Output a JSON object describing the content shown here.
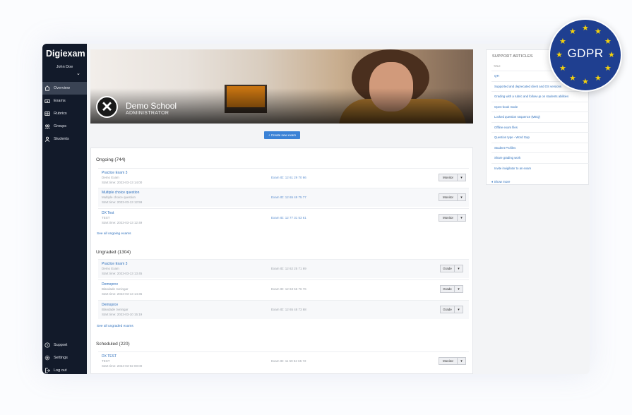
{
  "app": {
    "logo": "Digiexam"
  },
  "user": {
    "name": "John Doe"
  },
  "nav": {
    "items": [
      {
        "label": "Overview",
        "icon": "home-icon",
        "active": true
      },
      {
        "label": "Exams",
        "icon": "exams-icon",
        "active": false
      },
      {
        "label": "Rubrics",
        "icon": "rubrics-icon",
        "active": false
      },
      {
        "label": "Groups",
        "icon": "groups-icon",
        "active": false
      },
      {
        "label": "Students",
        "icon": "students-icon",
        "active": false
      }
    ],
    "bottom": [
      {
        "label": "Support",
        "icon": "help-icon"
      },
      {
        "label": "Settings",
        "icon": "gear-icon"
      },
      {
        "label": "Log out",
        "icon": "logout-icon"
      }
    ]
  },
  "banner": {
    "school_name": "Demo School",
    "role": "ADMINISTRATOR",
    "logo_glyph": "✕"
  },
  "create_button": "+ Create new exam",
  "ongoing": {
    "title": "Ongoing (744)",
    "see_all": "See all ongoing exams",
    "exams": [
      {
        "title": "Practice Exam 3",
        "sub": "Demo Exam",
        "start": "Start time: 2023-03-13 14:00",
        "exam_id": "Exam ID: 12 61 29 70 66",
        "action": "Monitor"
      },
      {
        "title": "Multiple choice question",
        "sub": "Multiple choice question",
        "start": "Start time: 2023-03-13 12:59",
        "exam_id": "Exam ID: 12 65 49 75 77",
        "action": "Monitor"
      },
      {
        "title": "DX Test",
        "sub": "TEST",
        "start": "Start time: 2023-03-13 12:49",
        "exam_id": "Exam ID: 12 77 31 53 61",
        "action": "Monitor"
      }
    ]
  },
  "ungraded": {
    "title": "Ungraded (1304)",
    "see_all": "See all ungraded exams",
    "exams": [
      {
        "title": "Practice Exam 3",
        "sub": "Demo Exam",
        "start": "Start time: 2023-03-13 13:45",
        "exam_id": "Exam ID: 12 62 25 71 69",
        "action": "Grade"
      },
      {
        "title": "Demoprov",
        "sub": "Blandade övningar",
        "start": "Start time: 2023-03-13 14:36",
        "exam_id": "Exam ID: 12 63 56 76 76",
        "action": "Grade"
      },
      {
        "title": "Demoprov",
        "sub": "Blandade övningar",
        "start": "Start time: 2023-03-10 15:19",
        "exam_id": "Exam ID: 12 65 48 73 68",
        "action": "Grade"
      }
    ]
  },
  "scheduled": {
    "title": "Scheduled (220)",
    "exams": [
      {
        "title": "DX TEST",
        "sub": "TEST",
        "start": "Start time: 2024-03-02 00:00",
        "exam_id": "Exam ID: 11 59 52 65 72",
        "action": "Monitor"
      }
    ]
  },
  "support": {
    "heading": "SUPPORT ARTICLES",
    "column": "TITLE",
    "articles": [
      "QTI",
      "Supported and deprecated client and OS versions",
      "Grading with a rubric and follow up on students abilities",
      "Open-book mode",
      "Locked question sequence (MEQ)",
      "Offline exam files",
      "Question type - Word Gap",
      "Student Profiles",
      "Share grading work",
      "Invite invigilator to an exam"
    ],
    "show_more": "Show more"
  },
  "gdpr": {
    "label": "GDPR"
  },
  "colors": {
    "sidebar": "#121a2a",
    "link": "#2d6fbc",
    "button": "#3b82d6",
    "gdpr": "#1f3f90",
    "star": "#f5d20c"
  }
}
